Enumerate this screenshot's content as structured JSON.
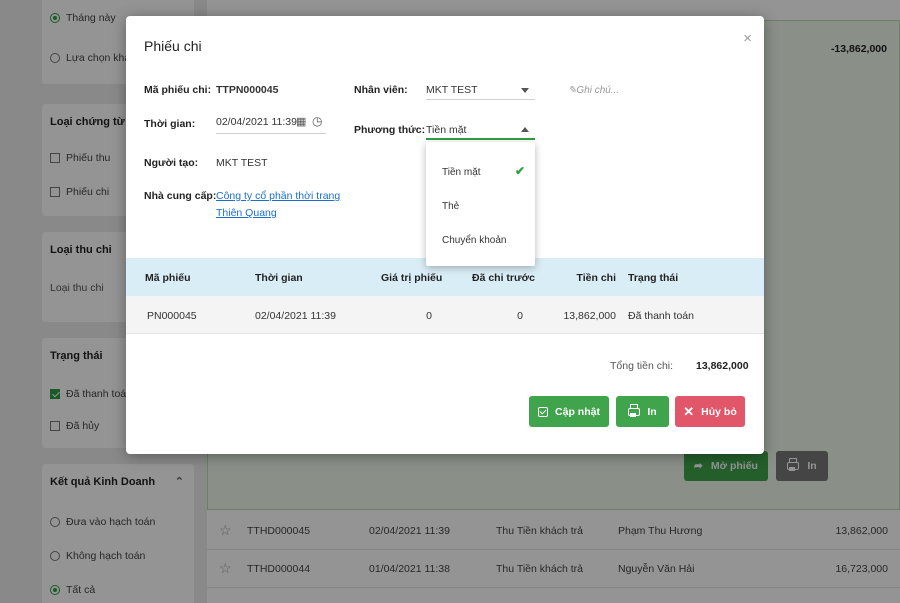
{
  "sidebar": {
    "time_options": [
      "Tháng này",
      "Lựa chọn khác"
    ],
    "doc_type": {
      "title": "Loại chứng từ",
      "options": [
        "Phiếu thu",
        "Phiếu chi"
      ]
    },
    "income_type": {
      "title": "Loại thu chi",
      "placeholder": "Loại thu chi"
    },
    "status": {
      "title": "Trạng thái",
      "options": [
        "Đã thanh toán",
        "Đã hủy"
      ]
    },
    "business_result": {
      "title": "Kết quả Kinh Doanh",
      "options": [
        "Đưa vào hạch toán",
        "Không hạch toán",
        "Tất cả"
      ]
    }
  },
  "background": {
    "expanded_value": "-13,862,000",
    "open_button": "Mở phiếu",
    "print_button": "In",
    "rows": [
      {
        "code": "TTHD000045",
        "time": "02/04/2021 11:39",
        "type": "Thu Tiền khách trả",
        "person": "Phạm Thu Hương",
        "amount": "13,862,000"
      },
      {
        "code": "TTHD000044",
        "time": "01/04/2021 11:38",
        "type": "Thu Tiền khách trả",
        "person": "Nguyễn Văn Hải",
        "amount": "16,723,000"
      }
    ]
  },
  "modal": {
    "title": "Phiếu chi",
    "close": "×",
    "voucher_code_label": "Mã phiếu chi:",
    "voucher_code": "TTPN000045",
    "time_label": "Thời gian:",
    "time_value": "02/04/2021 11:39",
    "creator_label": "Người tạo:",
    "creator_value": "MKT TEST",
    "supplier_label": "Nhà cung cấp:",
    "supplier_value_1": "Công ty cổ phần thời trang",
    "supplier_value_2": "Thiên Quang",
    "employee_label": "Nhân viên:",
    "employee_value": "MKT TEST",
    "method_label": "Phương thức:",
    "method_value": "Tiền mặt",
    "note_placeholder": "Ghi chú...",
    "method_options": [
      "Tiền mặt",
      "Thẻ",
      "Chuyển khoản"
    ],
    "table": {
      "headers": [
        "Mã phiếu",
        "Thời gian",
        "Giá trị phiếu",
        "Đã chi trước",
        "Tiền chi",
        "Trạng thái"
      ],
      "rows": [
        [
          "PN000045",
          "02/04/2021 11:39",
          "0",
          "0",
          "13,862,000",
          "Đã thanh toán"
        ]
      ]
    },
    "total_label": "Tổng tiền chi:",
    "total_value": "13,862,000",
    "buttons": {
      "update": "Cập nhật",
      "print": "In",
      "cancel": "Hủy bỏ"
    }
  }
}
